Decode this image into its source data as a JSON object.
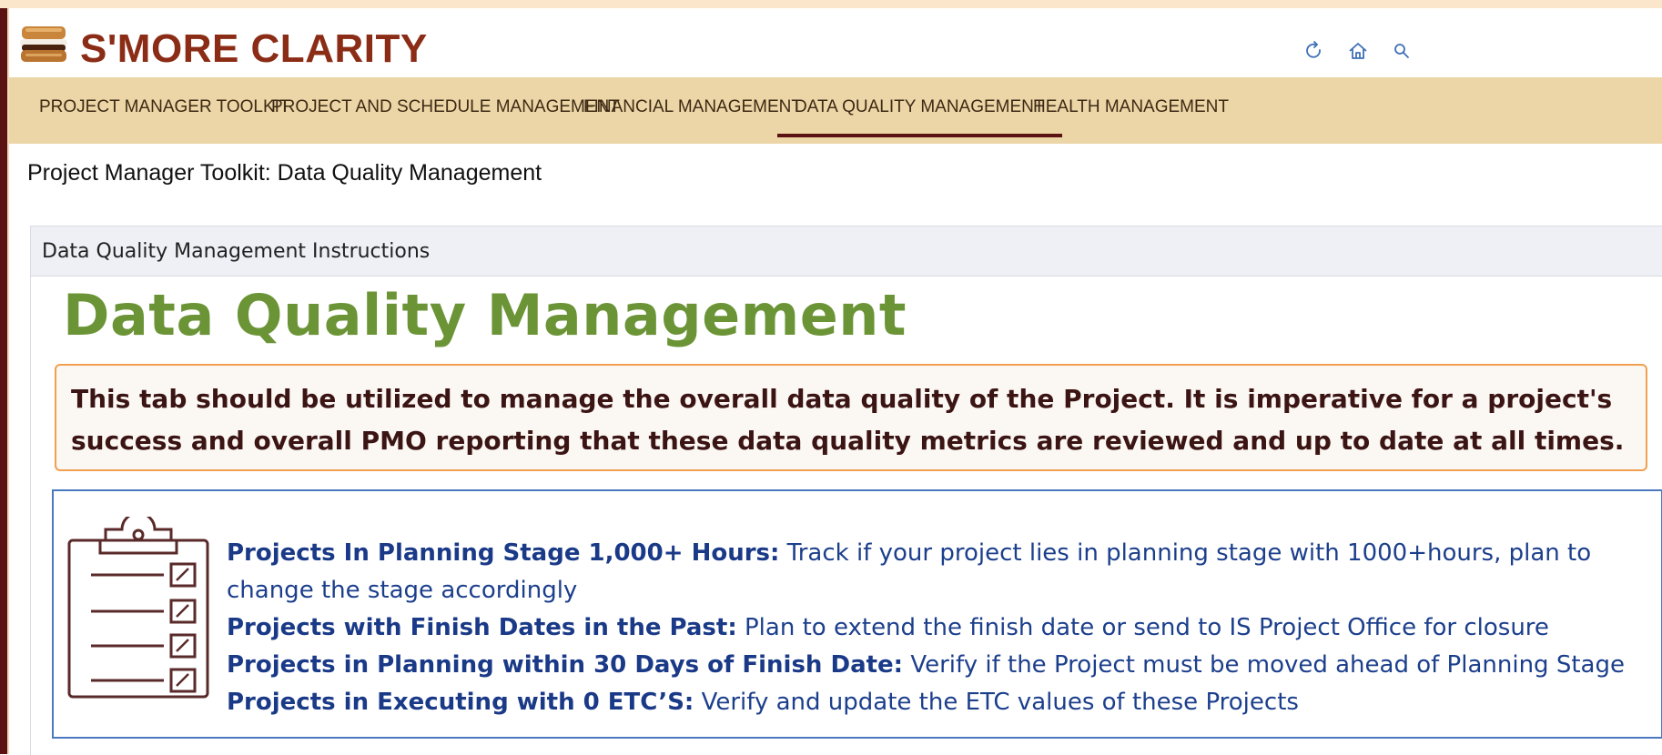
{
  "app": {
    "title": "S'MORE CLARITY",
    "brand_color": "#8b2d16",
    "nav_color": "#ecd5a6"
  },
  "header_icons": {
    "refresh": "refresh-icon",
    "home": "home-icon",
    "search": "search-icon"
  },
  "nav": {
    "items": [
      {
        "label": "PROJECT MANAGER TOOLKIT"
      },
      {
        "label": "PROJECT AND SCHEDULE MANAGEMENT"
      },
      {
        "label": "FINANCIAL MANAGEMENT"
      },
      {
        "label": "DATA QUALITY MANAGEMENT",
        "active": true
      },
      {
        "label": "HEALTH MANAGEMENT"
      }
    ]
  },
  "page": {
    "title": "Project Manager Toolkit: Data Quality Management"
  },
  "panel": {
    "title": "Data Quality Management Instructions",
    "heading": "Data Quality Management",
    "intro": "This tab should be utilized to manage the overall data quality of the Project. It is imperative for a project's success and overall PMO reporting that these data quality metrics are reviewed and up to date at all times.",
    "metrics": [
      {
        "label": "Projects In Planning Stage 1,000+ Hours:",
        "text": "  Track if your project lies in planning stage with 1000+hours, plan to change the stage accordingly"
      },
      {
        "label": "Projects with Finish Dates in the Past:",
        "text": " Plan to extend the finish date or send to IS Project Office for closure"
      },
      {
        "label": "Projects in Planning within 30 Days of Finish Date:",
        "text": " Verify if the Project must be moved ahead of Planning Stage"
      },
      {
        "label": "Projects in Executing with 0 ETC’S:",
        "text": " Verify and update the ETC values of these Projects"
      }
    ]
  }
}
